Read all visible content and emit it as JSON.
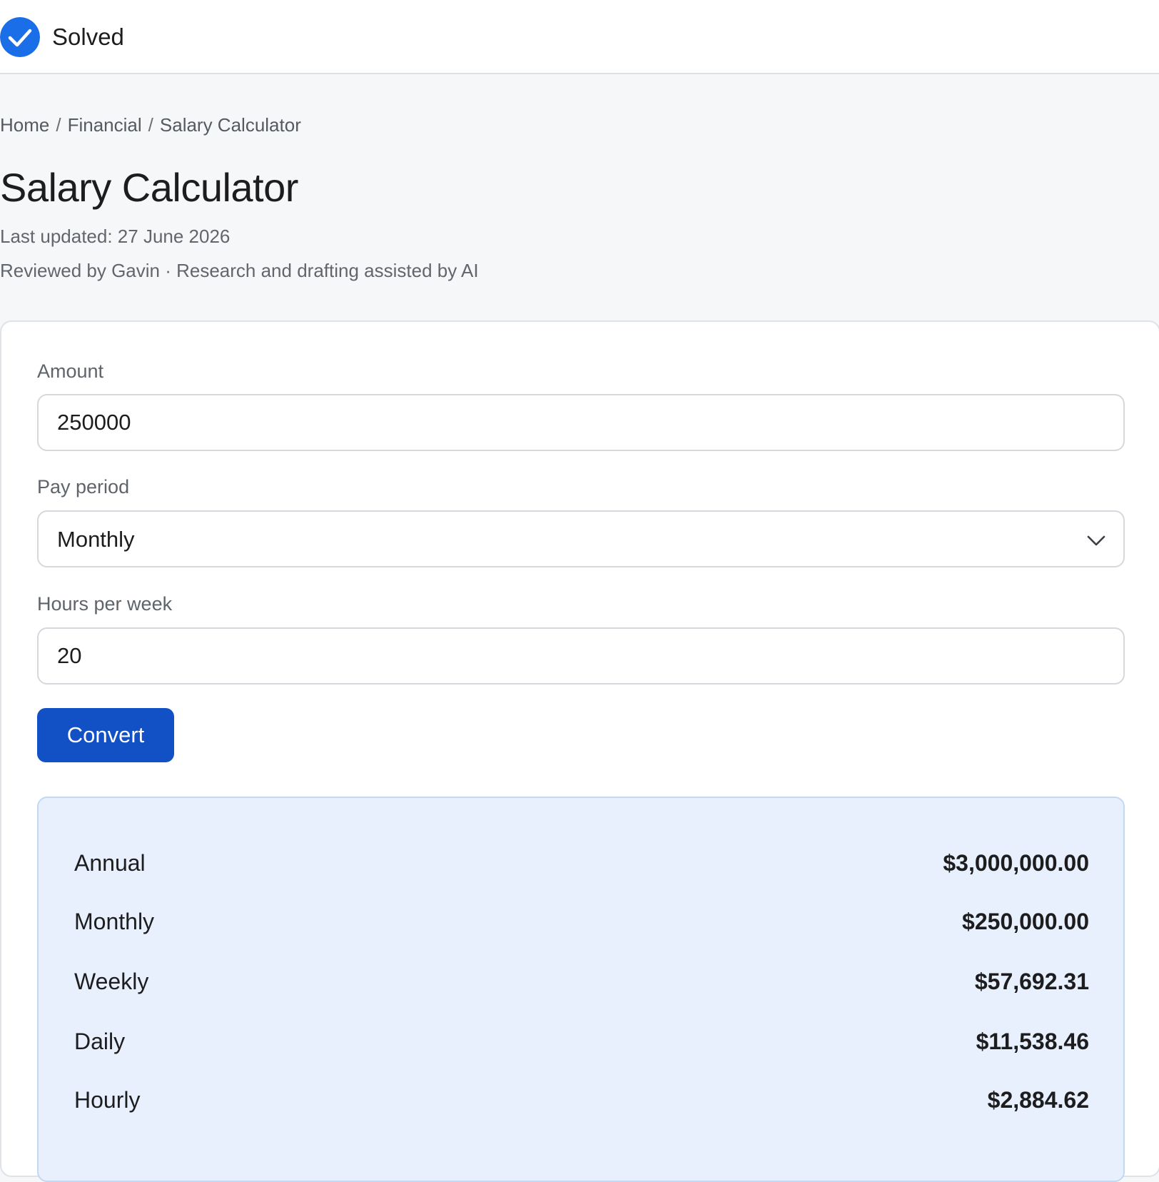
{
  "status": {
    "label": "Solved",
    "icon": "check-circle-icon",
    "color": "#1a6fe8"
  },
  "breadcrumb": {
    "items": [
      "Home",
      "Financial",
      "Salary Calculator"
    ],
    "separator": "/"
  },
  "page": {
    "title": "Salary Calculator",
    "last_updated": "Last updated: 27 June 2026",
    "reviewed": "Reviewed by Gavin · Research and drafting assisted by AI"
  },
  "form": {
    "amount": {
      "label": "Amount",
      "value": "250000"
    },
    "pay_period": {
      "label": "Pay period",
      "value": "Monthly",
      "icon": "chevron-down-icon"
    },
    "hours_per_week": {
      "label": "Hours per week",
      "value": "20"
    },
    "convert_label": "Convert",
    "accent_color": "#1250c6"
  },
  "results": {
    "background": "#e7f0fc",
    "rows": [
      {
        "label": "Annual",
        "value": "$3,000,000.00"
      },
      {
        "label": "Monthly",
        "value": "$250,000.00"
      },
      {
        "label": "Weekly",
        "value": "$57,692.31"
      },
      {
        "label": "Daily",
        "value": "$11,538.46"
      },
      {
        "label": "Hourly",
        "value": "$2,884.62"
      }
    ]
  }
}
